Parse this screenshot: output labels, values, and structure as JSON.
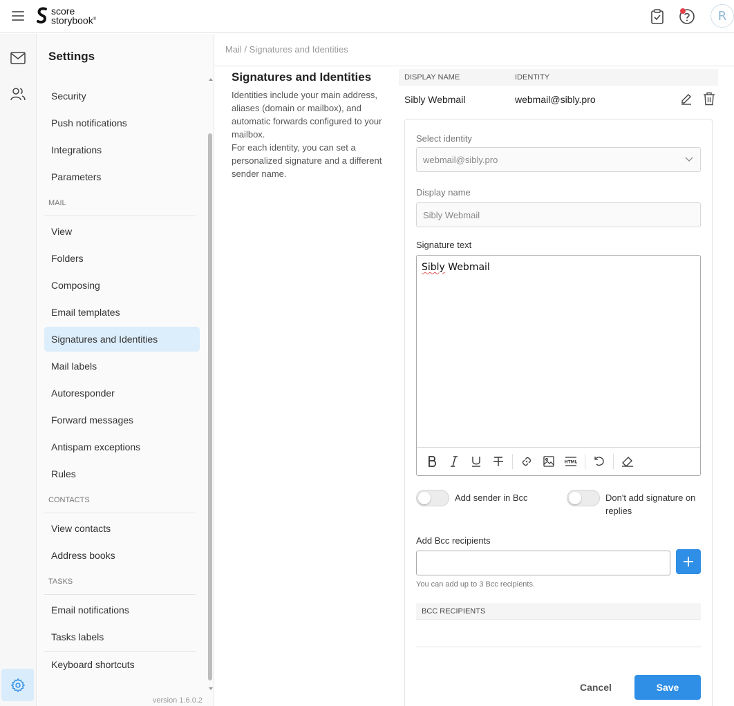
{
  "header": {
    "logo_line1": "score",
    "logo_line2": "storybook",
    "logo_reg": "®",
    "avatar_letter": "R",
    "notification_color": "#e4414a"
  },
  "settings": {
    "title": "Settings",
    "items_top": [
      {
        "label": "Security"
      },
      {
        "label": "Push notifications"
      },
      {
        "label": "Integrations"
      },
      {
        "label": "Parameters"
      }
    ],
    "sections": [
      {
        "title": "MAIL",
        "items": [
          {
            "label": "View"
          },
          {
            "label": "Folders"
          },
          {
            "label": "Composing"
          },
          {
            "label": "Email templates"
          },
          {
            "label": "Signatures and Identities",
            "active": true
          },
          {
            "label": "Mail labels"
          },
          {
            "label": "Autoresponder"
          },
          {
            "label": "Forward messages"
          },
          {
            "label": "Antispam exceptions"
          },
          {
            "label": "Rules"
          }
        ]
      },
      {
        "title": "CONTACTS",
        "items": [
          {
            "label": "View contacts"
          },
          {
            "label": "Address books"
          }
        ]
      },
      {
        "title": "TASKS",
        "items": [
          {
            "label": "Email notifications"
          },
          {
            "label": "Tasks labels"
          },
          {
            "label": "Keyboard shortcuts"
          }
        ]
      }
    ],
    "version": "version 1.6.0.2"
  },
  "breadcrumb": "Mail / Signatures and Identities",
  "intro": {
    "title": "Signatures and Identities",
    "text1": "Identities include your main address, aliases (domain or mailbox), and automatic forwards configured to your mailbox.",
    "text2": "For each identity, you can set a personalized signature and a different sender name."
  },
  "identities": {
    "columns": [
      "DISPLAY NAME",
      "IDENTITY"
    ],
    "rows": [
      {
        "display_name": "Sibly Webmail",
        "identity": "webmail@sibly.pro"
      }
    ]
  },
  "form": {
    "select_identity_label": "Select identity",
    "select_identity_value": "webmail@sibly.pro",
    "display_name_label": "Display name",
    "display_name_value": "Sibly Webmail",
    "signature_label": "Signature text",
    "signature_word1": "Sibly",
    "signature_word2": " Webmail",
    "toggle_bcc_label": "Add sender in Bcc",
    "toggle_no_sig_label": "Don't add signature on replies",
    "bcc_label": "Add Bcc recipients",
    "bcc_hint": "You can add up to 3 Bcc recipients.",
    "bcc_table_header": "BCC RECIPIENTS",
    "cancel_label": "Cancel",
    "save_label": "Save"
  },
  "colors": {
    "accent": "#2f8ee6",
    "active_bg": "#dcedfb"
  }
}
